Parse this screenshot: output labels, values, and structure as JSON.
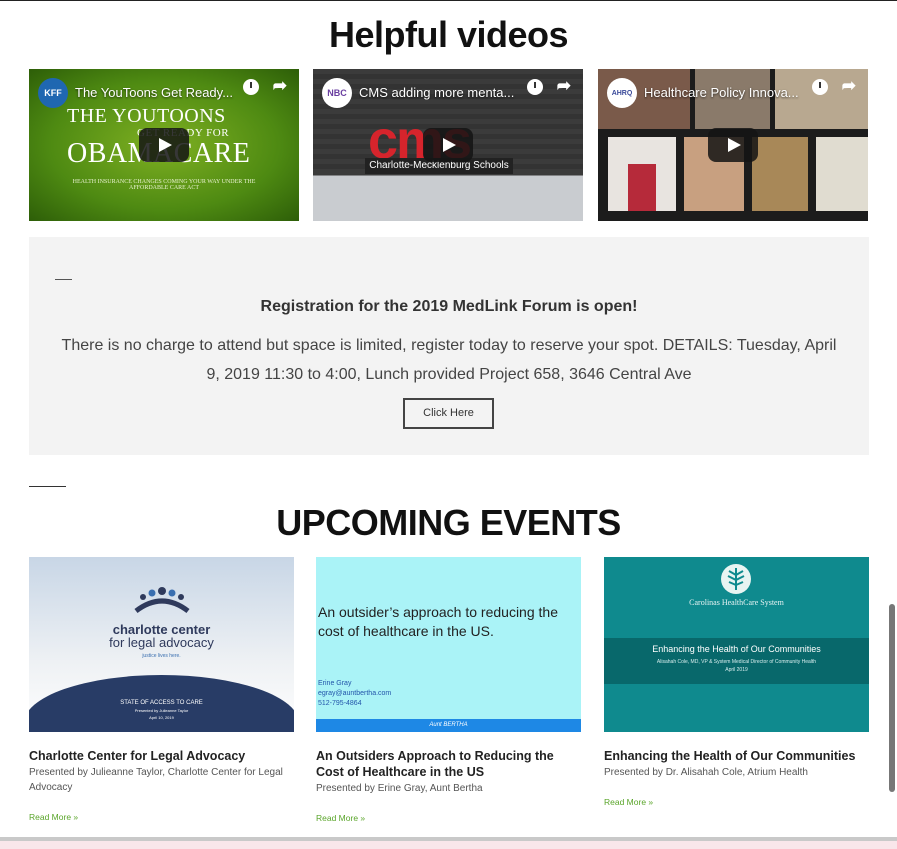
{
  "videos_section": {
    "title": "Helpful videos",
    "videos": [
      {
        "title": "The YouToons Get Ready...",
        "channel_logo": "KFF",
        "thumb_line1": "THE YOUTOONS",
        "thumb_line1b": "GET READY FOR",
        "thumb_line2": "OBAMACARE",
        "thumb_sub": "HEALTH INSURANCE CHANGES COMING YOUR WAY UNDER THE AFFORDABLE CARE ACT"
      },
      {
        "title": "CMS adding more menta...",
        "channel_logo": "NBC",
        "thumb_word": "cms",
        "thumb_sub": "Charlotte-Mecklenburg Schools"
      },
      {
        "title": "Healthcare Policy Innova...",
        "channel_logo": "AHRQ"
      }
    ]
  },
  "registration": {
    "title": "Registration for the 2019 MedLink Forum is open!",
    "text": "There is no charge to attend but space is limited, register today to reserve your spot. DETAILS: Tuesday, April 9, 2019 11:30 to 4:00, Lunch provided Project 658, 3646 Central Ave",
    "button_label": "Click Here"
  },
  "events_section": {
    "title": "UPCOMING EVENTS",
    "read_more": "Read More »",
    "events": [
      {
        "name": "Charlotte Center for Legal Advocacy",
        "presenter": "Presented by Julieanne Taylor, Charlotte Center for Legal Advocacy",
        "thumb": {
          "org1": "charlotte center",
          "org2": "for legal advocacy",
          "tagline": "justice lives here.",
          "state": "STATE OF ACCESS TO CARE",
          "state_by": "Presented by Julieanne Taylor",
          "state_date": "April 10, 2019"
        }
      },
      {
        "name": "An Outsiders Approach to Reducing the Cost of Healthcare in the US",
        "presenter": "Presented by Erine Gray, Aunt Bertha",
        "thumb": {
          "headline": "An outsider’s approach to reducing the cost of healthcare in the US.",
          "contact_name": "Erine Gray",
          "contact_email": "egray@auntbertha.com",
          "contact_phone": "512-795-4864",
          "brand": "Aunt BERTHA"
        }
      },
      {
        "name": "Enhancing the Health of Our Communities",
        "presenter": "Presented by Dr. Alisahah Cole, Atrium Health",
        "thumb": {
          "org": "Carolinas HealthCare System",
          "title": "Enhancing the Health of Our Communities",
          "sub": "Alisahah Cole, MD, VP & System Medical Director of Community Health",
          "date": "April 2019"
        }
      }
    ]
  },
  "colors": {
    "read_more": "#5aa52a",
    "registration_bg": "#f3f3f3",
    "cms_red": "#d6242c",
    "teal": "#0f8a8e"
  }
}
